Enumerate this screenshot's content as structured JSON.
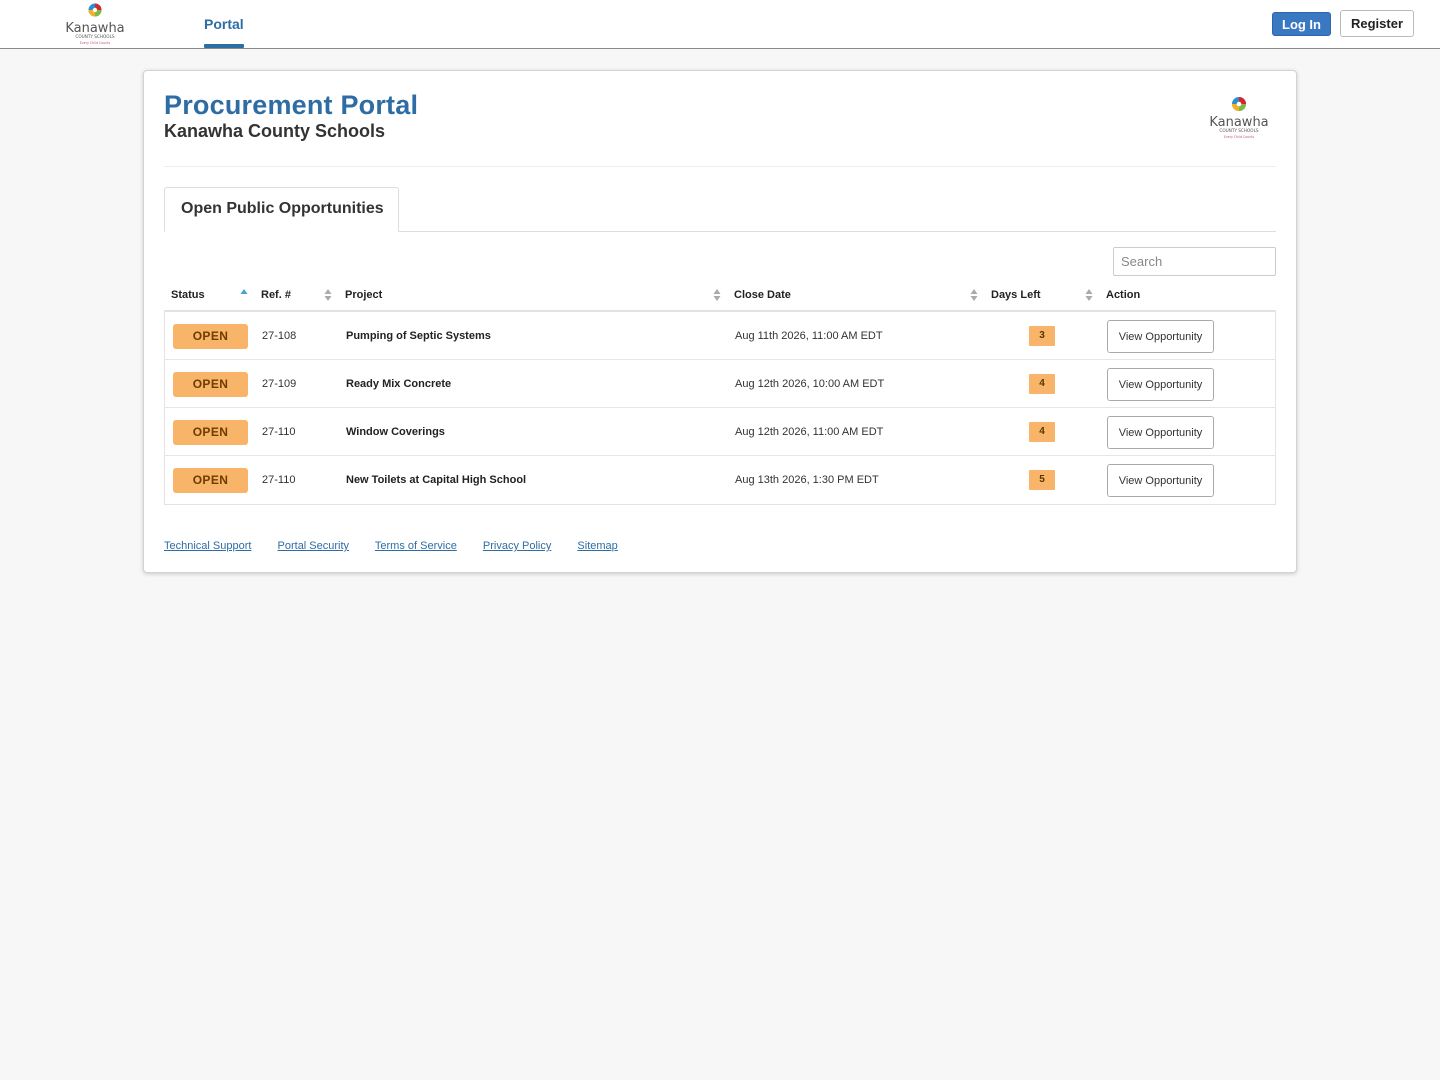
{
  "nav": {
    "portal_label": "Portal",
    "login_label": "Log In",
    "register_label": "Register"
  },
  "logo": {
    "name": "Kanawha",
    "tagline": "COUNTY SCHOOLS",
    "motto": "Every Child Counts",
    "colors": [
      "#d9262e",
      "#2b8fd0",
      "#7dbb42",
      "#f4b223"
    ]
  },
  "header": {
    "title": "Procurement Portal",
    "subtitle": "Kanawha County Schools"
  },
  "tabs": [
    {
      "label": "Open Public Opportunities",
      "active": true
    }
  ],
  "search": {
    "placeholder": "Search"
  },
  "table": {
    "columns": [
      "Status",
      "Ref. #",
      "Project",
      "Close Date",
      "Days Left",
      "Action"
    ],
    "rows": [
      {
        "status": "OPEN",
        "ref": "27-108",
        "project": "Pumping of Septic Systems",
        "close_date": "Aug 11th 2026, 11:00 AM EDT",
        "days_left": "3",
        "action": "View Opportunity"
      },
      {
        "status": "OPEN",
        "ref": "27-109",
        "project": "Ready Mix Concrete",
        "close_date": "Aug 12th 2026, 10:00 AM EDT",
        "days_left": "4",
        "action": "View Opportunity"
      },
      {
        "status": "OPEN",
        "ref": "27-110",
        "project": "Window Coverings",
        "close_date": "Aug 12th 2026, 11:00 AM EDT",
        "days_left": "4",
        "action": "View Opportunity"
      },
      {
        "status": "OPEN",
        "ref": "27-110",
        "project": "New Toilets at Capital High School",
        "close_date": "Aug 13th 2026, 1:30 PM EDT",
        "days_left": "5",
        "action": "View Opportunity"
      }
    ]
  },
  "footer": {
    "links": [
      "Technical Support",
      "Portal Security",
      "Terms of Service",
      "Privacy Policy",
      "Sitemap"
    ]
  },
  "colors": {
    "brand_blue": "#2e6da4",
    "login_blue": "#3a78c2",
    "open_orange": "#f8b469",
    "page_bg": "#f7f7f7"
  }
}
